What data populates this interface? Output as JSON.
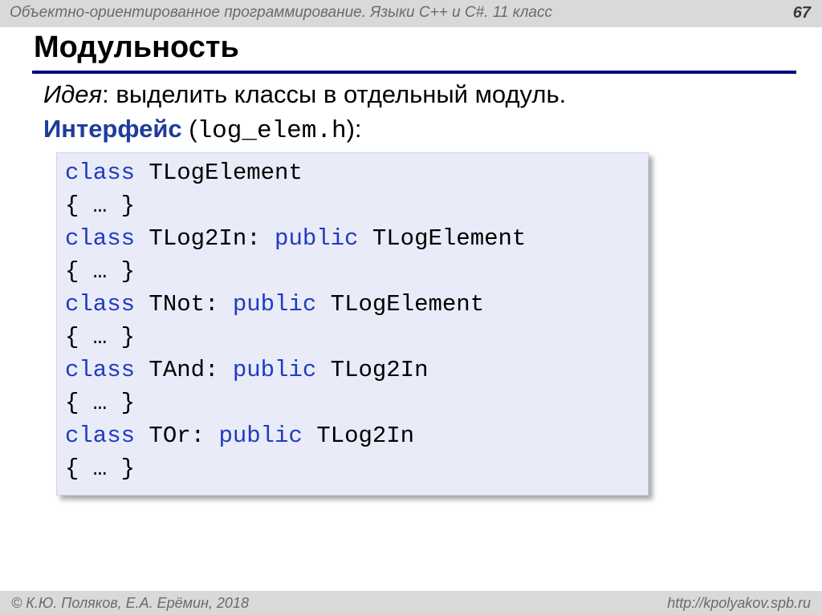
{
  "header": {
    "course_title": "Объектно-ориентированное программирование. Языки С++ и С#. 11 класс",
    "page_number": "67"
  },
  "slide": {
    "title": "Модульность",
    "idea_label": "Идея",
    "idea_text": ": выделить классы в отдельный модуль.",
    "interface_label": "Интерфейс",
    "interface_open": " (",
    "interface_file": "log_elem.h",
    "interface_close": "):"
  },
  "code": {
    "lines": [
      {
        "kw": "class",
        "name": " TLogElement",
        "kw2": "",
        "base": ""
      },
      {
        "body": "{ … }"
      },
      {
        "kw": "class",
        "name": " TLog2In: ",
        "kw2": "public",
        "base": " TLogElement"
      },
      {
        "body": "{ … }"
      },
      {
        "kw": "class",
        "name": " TNot: ",
        "kw2": "public",
        "base": " TLogElement"
      },
      {
        "body": "{ … }"
      },
      {
        "kw": "class",
        "name": " TAnd: ",
        "kw2": "public",
        "base": " TLog2In"
      },
      {
        "body": "{ … }"
      },
      {
        "kw": "class",
        "name": " TOr: ",
        "kw2": "public",
        "base": " TLog2In"
      },
      {
        "body": "{ … }"
      }
    ]
  },
  "footer": {
    "copyright": "© К.Ю. Поляков, Е.А. Ерёмин, 2018",
    "url": "http://kpolyakov.spb.ru"
  },
  "colors": {
    "keyword": "#1f3cbf",
    "title_rule": "#000080",
    "code_background": "#e9ebf8",
    "bar_background": "#d9d9d9"
  }
}
